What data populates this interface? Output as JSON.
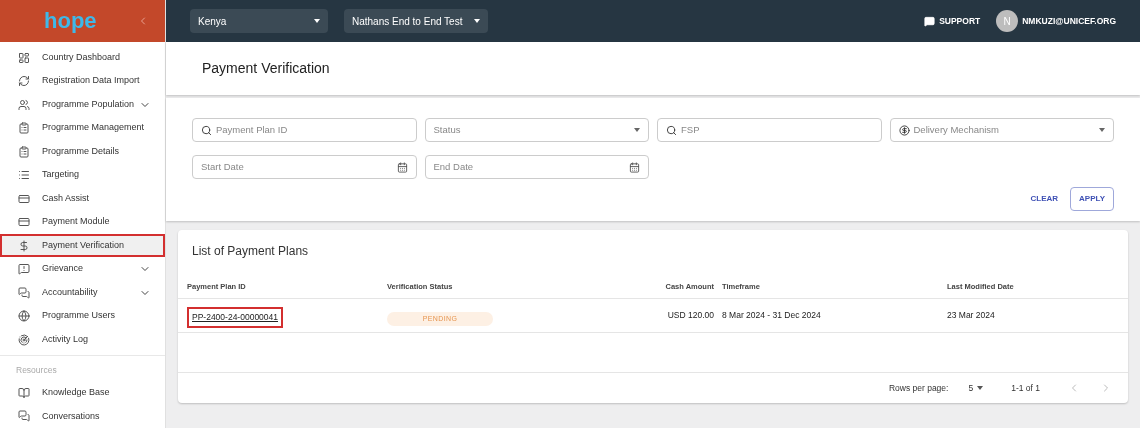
{
  "logo": "hope",
  "sidebar": {
    "items": [
      {
        "label": "Country Dashboard",
        "expandable": false,
        "selected": false
      },
      {
        "label": "Registration Data Import",
        "expandable": false,
        "selected": false
      },
      {
        "label": "Programme Population",
        "expandable": true,
        "selected": false
      },
      {
        "label": "Programme Management",
        "expandable": false,
        "selected": false
      },
      {
        "label": "Programme Details",
        "expandable": false,
        "selected": false
      },
      {
        "label": "Targeting",
        "expandable": false,
        "selected": false
      },
      {
        "label": "Cash Assist",
        "expandable": false,
        "selected": false
      },
      {
        "label": "Payment Module",
        "expandable": false,
        "selected": false
      },
      {
        "label": "Payment Verification",
        "expandable": false,
        "selected": true
      },
      {
        "label": "Grievance",
        "expandable": true,
        "selected": false
      },
      {
        "label": "Accountability",
        "expandable": true,
        "selected": false
      },
      {
        "label": "Programme Users",
        "expandable": false,
        "selected": false
      },
      {
        "label": "Activity Log",
        "expandable": false,
        "selected": false
      }
    ],
    "section": "Resources",
    "resources": [
      {
        "label": "Knowledge Base"
      },
      {
        "label": "Conversations"
      }
    ]
  },
  "topbar": {
    "country": "Kenya",
    "programme": "Nathans End to End Test",
    "support": "SUPPORT",
    "avatar": "N",
    "user": "NMKUZI@UNICEF.ORG"
  },
  "page_title": "Payment Verification",
  "filters": [
    {
      "kind": "search",
      "placeholder": "Payment Plan ID"
    },
    {
      "kind": "select",
      "placeholder": "Status"
    },
    {
      "kind": "search",
      "placeholder": "FSP"
    },
    {
      "kind": "money-select",
      "placeholder": "Delivery Mechanism"
    },
    {
      "kind": "date",
      "placeholder": "Start Date"
    },
    {
      "kind": "date",
      "placeholder": "End Date"
    }
  ],
  "buttons": {
    "clear": "CLEAR",
    "apply": "APPLY"
  },
  "table": {
    "title": "List of Payment Plans",
    "columns": [
      "Payment Plan ID",
      "Verification Status",
      "Cash Amount",
      "Timeframe",
      "Last Modified Date"
    ],
    "rows": [
      {
        "id": "PP-2400-24-00000041",
        "highlighted": true,
        "status": "PENDING",
        "amount": "USD 120.00",
        "timeframe": "8 Mar 2024 - 31 Dec 2024",
        "modified": "23 Mar 2024"
      }
    ],
    "pagination": {
      "rows_label": "Rows per page:",
      "rows_value": "5",
      "range": "1-1 of 1"
    }
  }
}
